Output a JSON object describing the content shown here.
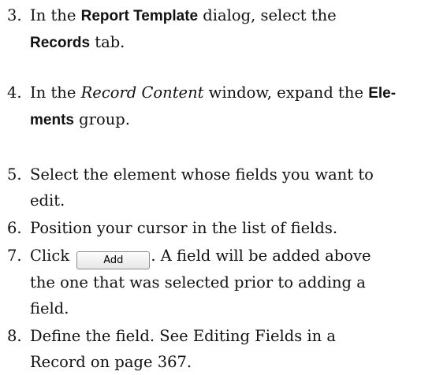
{
  "steps": [
    {
      "number": "3.",
      "line1_pre": "In the ",
      "line1_bold": "Report Template",
      "line1_post": " dialog, select the",
      "line2_bold": "Records",
      "line2_post": " tab."
    },
    {
      "number": "4.",
      "line1_pre": "In the ",
      "line1_italic": "Record Content",
      "line1_mid": " window, expand the ",
      "line1_bold": "Ele-",
      "line2_bold": "ments",
      "line2_post": " group."
    },
    {
      "number": "5.",
      "line1": "Select the element whose fields you want to",
      "line2": "edit."
    },
    {
      "number": "6.",
      "line1": "Position your cursor in the list of fields."
    },
    {
      "number": "7.",
      "line1_pre": "Click ",
      "button_label": "Add",
      "line1_post": ". A field will be added above",
      "line2": "the one that was selected prior to adding a",
      "line3": "field."
    },
    {
      "number": "8.",
      "line1": "Define the field. See Editing Fields in a",
      "line2": "Record on page 367."
    }
  ]
}
